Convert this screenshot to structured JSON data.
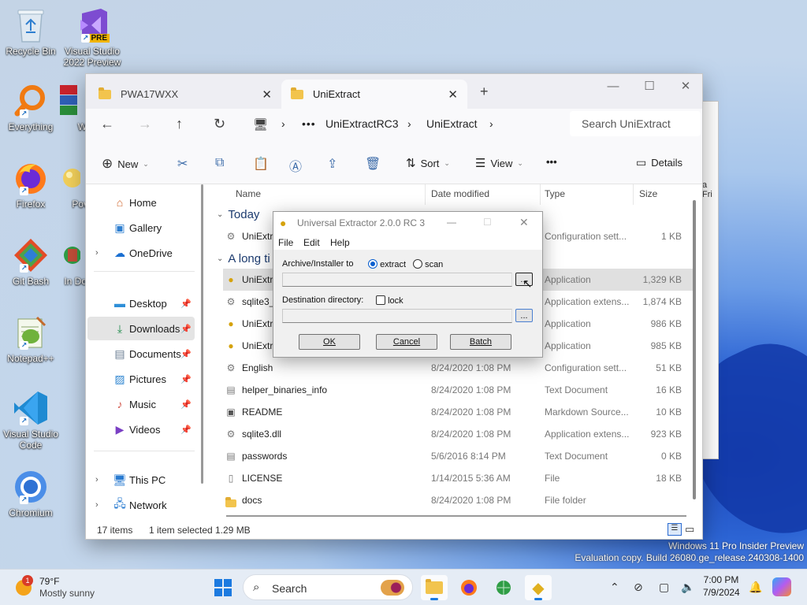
{
  "desktop": {
    "icons": [
      {
        "label": "Recycle Bin",
        "icon": "recycle-bin-icon"
      },
      {
        "label": "Visual Studio 2022 Preview",
        "badge": "PRE",
        "icon": "visual-studio-preview-icon"
      },
      {
        "label": "Everything",
        "icon": "everything-search-icon"
      },
      {
        "label": "W",
        "icon": "winrar-icon"
      },
      {
        "label": "Firefox",
        "icon": "firefox-icon"
      },
      {
        "label": "Pov",
        "icon": "povray-icon"
      },
      {
        "label": "Git Bash",
        "icon": "git-bash-icon"
      },
      {
        "label": "In Do",
        "icon": "internet-download-icon"
      },
      {
        "label": "Notepad++",
        "icon": "notepad-plus-plus-icon"
      },
      {
        "label": "Visual Studio Code",
        "icon": "vscode-icon"
      },
      {
        "label": "Chromium",
        "icon": "chromium-icon"
      }
    ],
    "bg_window_text": "a Fri",
    "watermark": {
      "line1": "Windows 11 Pro Insider Preview",
      "line2": "Evaluation copy. Build 26080.ge_release.240308-1400"
    }
  },
  "explorer": {
    "tabs": [
      {
        "label": "PWA17WXX",
        "active": false
      },
      {
        "label": "UniExtract",
        "active": true
      }
    ],
    "breadcrumb": [
      "UniExtractRC3",
      "UniExtract"
    ],
    "search_placeholder": "Search UniExtract",
    "toolbar": {
      "new": "New",
      "sort": "Sort",
      "view": "View",
      "more": "•••",
      "details": "Details"
    },
    "sidebar": [
      {
        "label": "Home",
        "icon": "home-icon"
      },
      {
        "label": "Gallery",
        "icon": "gallery-icon"
      },
      {
        "label": "OneDrive",
        "icon": "onedrive-icon"
      },
      {
        "label": "Desktop",
        "icon": "desktop-folder-icon",
        "pinned": true
      },
      {
        "label": "Downloads",
        "icon": "downloads-icon",
        "pinned": true,
        "selected": true
      },
      {
        "label": "Documents",
        "icon": "documents-icon",
        "pinned": true
      },
      {
        "label": "Pictures",
        "icon": "pictures-icon",
        "pinned": true
      },
      {
        "label": "Music",
        "icon": "music-icon",
        "pinned": true
      },
      {
        "label": "Videos",
        "icon": "videos-icon",
        "pinned": true
      },
      {
        "label": "This PC",
        "icon": "this-pc-icon"
      },
      {
        "label": "Network",
        "icon": "network-icon"
      }
    ],
    "columns": {
      "name": "Name",
      "date": "Date modified",
      "type": "Type",
      "size": "Size"
    },
    "groups": {
      "today": "Today",
      "long_ago": "A long ti"
    },
    "files": [
      {
        "name": "UniExtr",
        "date": "",
        "type": "Configuration sett...",
        "size": "1 KB"
      },
      {
        "name": "UniExtr",
        "date": "",
        "type": "Application",
        "size": "1,329 KB",
        "selected": true
      },
      {
        "name": "sqlite3_",
        "date": "",
        "type": "Application extens...",
        "size": "1,874 KB"
      },
      {
        "name": "UniExtr",
        "date": "",
        "type": "Application",
        "size": "986 KB"
      },
      {
        "name": "UniExtr",
        "date": "",
        "type": "Application",
        "size": "985 KB"
      },
      {
        "name": "English",
        "date": "8/24/2020 1:08 PM",
        "type": "Configuration sett...",
        "size": "51 KB"
      },
      {
        "name": "helper_binaries_info",
        "date": "8/24/2020 1:08 PM",
        "type": "Text Document",
        "size": "16 KB"
      },
      {
        "name": "README",
        "date": "8/24/2020 1:08 PM",
        "type": "Markdown Source...",
        "size": "10 KB"
      },
      {
        "name": "sqlite3.dll",
        "date": "8/24/2020 1:08 PM",
        "type": "Application extens...",
        "size": "923 KB"
      },
      {
        "name": "passwords",
        "date": "5/6/2016 8:14 PM",
        "type": "Text Document",
        "size": "0 KB"
      },
      {
        "name": "LICENSE",
        "date": "1/14/2015 5:36 AM",
        "type": "File",
        "size": "18 KB"
      },
      {
        "name": "docs",
        "date": "8/24/2020 1:08 PM",
        "type": "File folder",
        "size": ""
      }
    ],
    "status": {
      "count": "17 items",
      "selection": "1 item selected",
      "size": "1.29 MB"
    }
  },
  "dialog": {
    "title": "Universal Extractor 2.0.0 RC 3",
    "menu": [
      "File",
      "Edit",
      "Help"
    ],
    "archive_label": "Archive/Installer to",
    "extract_label": "extract",
    "scan_label": "scan",
    "mode": "extract",
    "archive_value": "",
    "dest_label": "Destination directory:",
    "lock_label": "lock",
    "lock_checked": false,
    "dest_value": "",
    "browse_label": "...",
    "ok_label": "OK",
    "cancel_label": "Cancel",
    "batch_label": "Batch"
  },
  "taskbar": {
    "weather": {
      "temp": "79°F",
      "desc": "Mostly sunny",
      "alert_count": "1"
    },
    "search_label": "Search",
    "time": "7:00 PM",
    "date": "7/9/2024"
  }
}
